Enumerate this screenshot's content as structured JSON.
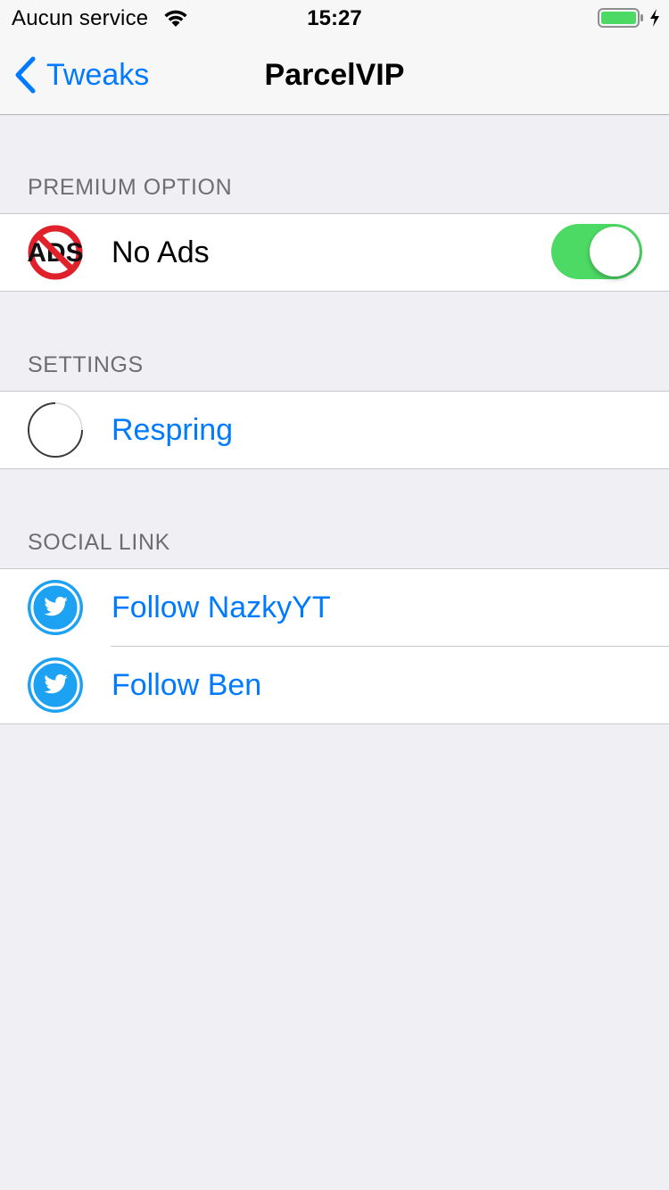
{
  "status_bar": {
    "carrier": "Aucun service",
    "time": "15:27",
    "battery_level": 1.0
  },
  "nav": {
    "back_label": "Tweaks",
    "title": "ParcelVIP"
  },
  "sections": {
    "premium": {
      "header": "PREMIUM OPTION",
      "items": [
        {
          "label": "No Ads",
          "icon": "no-ads-icon",
          "toggle": true,
          "icon_text": "ADS"
        }
      ]
    },
    "settings": {
      "header": "SETTINGS",
      "items": [
        {
          "label": "Respring",
          "icon": "respring-icon"
        }
      ]
    },
    "social": {
      "header": "SOCIAL LINK",
      "items": [
        {
          "label": "Follow NazkyYT",
          "icon": "twitter-icon"
        },
        {
          "label": "Follow Ben",
          "icon": "twitter-icon"
        }
      ]
    }
  },
  "colors": {
    "accent": "#007aff",
    "switch_on": "#4cd964",
    "twitter": "#1da1f2",
    "background": "#efeff4"
  }
}
